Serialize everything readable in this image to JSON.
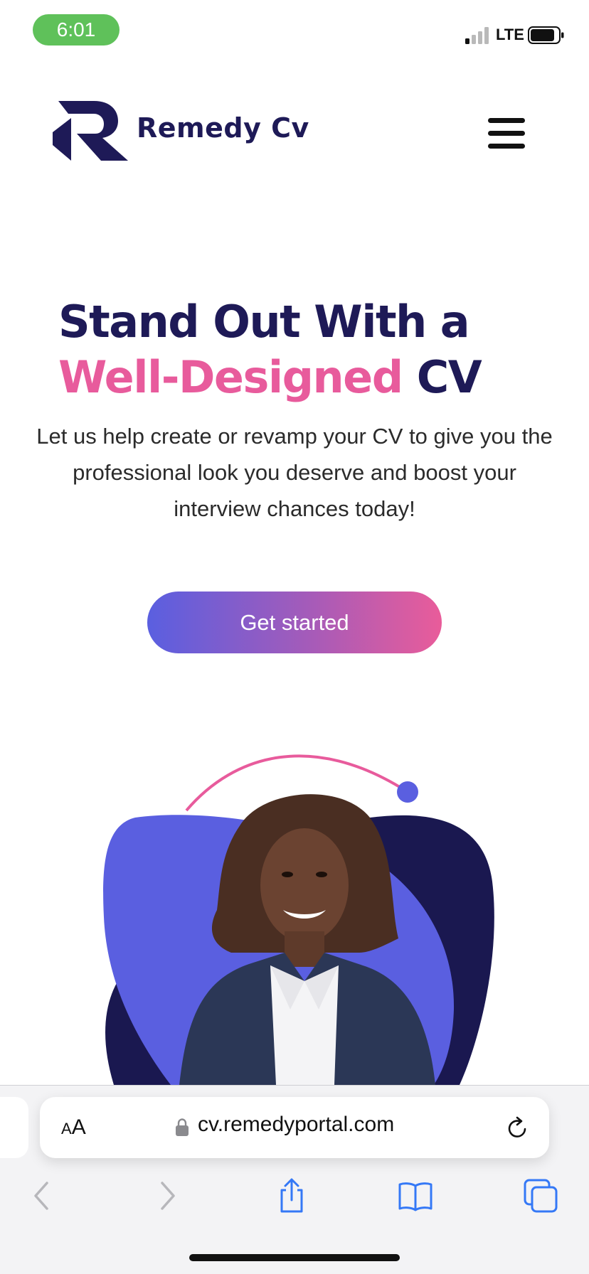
{
  "status_bar": {
    "time": "6:01",
    "network": "LTE",
    "colors": {
      "time_pill": "#5fc15a"
    }
  },
  "header": {
    "brand_name": "Remedy Cv",
    "icons": {
      "logo": "remedy-logo-icon",
      "menu": "hamburger-menu-icon"
    }
  },
  "hero": {
    "title_line1": "Stand Out With a",
    "title_accent": "Well-Designed",
    "title_end": "CV",
    "subtitle": "Let us help create or revamp your CV to give you the professional look you deserve and boost your interview chances today!",
    "cta_label": "Get started",
    "colors": {
      "navy": "#1e1a57",
      "pink": "#e85b9c",
      "violet": "#5a5fe0"
    }
  },
  "browser": {
    "text_size_small": "A",
    "text_size_big": "A",
    "url": "cv.remedyportal.com",
    "icons": {
      "back": "chevron-left-icon",
      "forward": "chevron-right-icon",
      "share": "share-icon",
      "bookmarks": "book-icon",
      "tabs": "tabs-icon",
      "lock": "lock-icon",
      "reload": "reload-icon"
    }
  }
}
